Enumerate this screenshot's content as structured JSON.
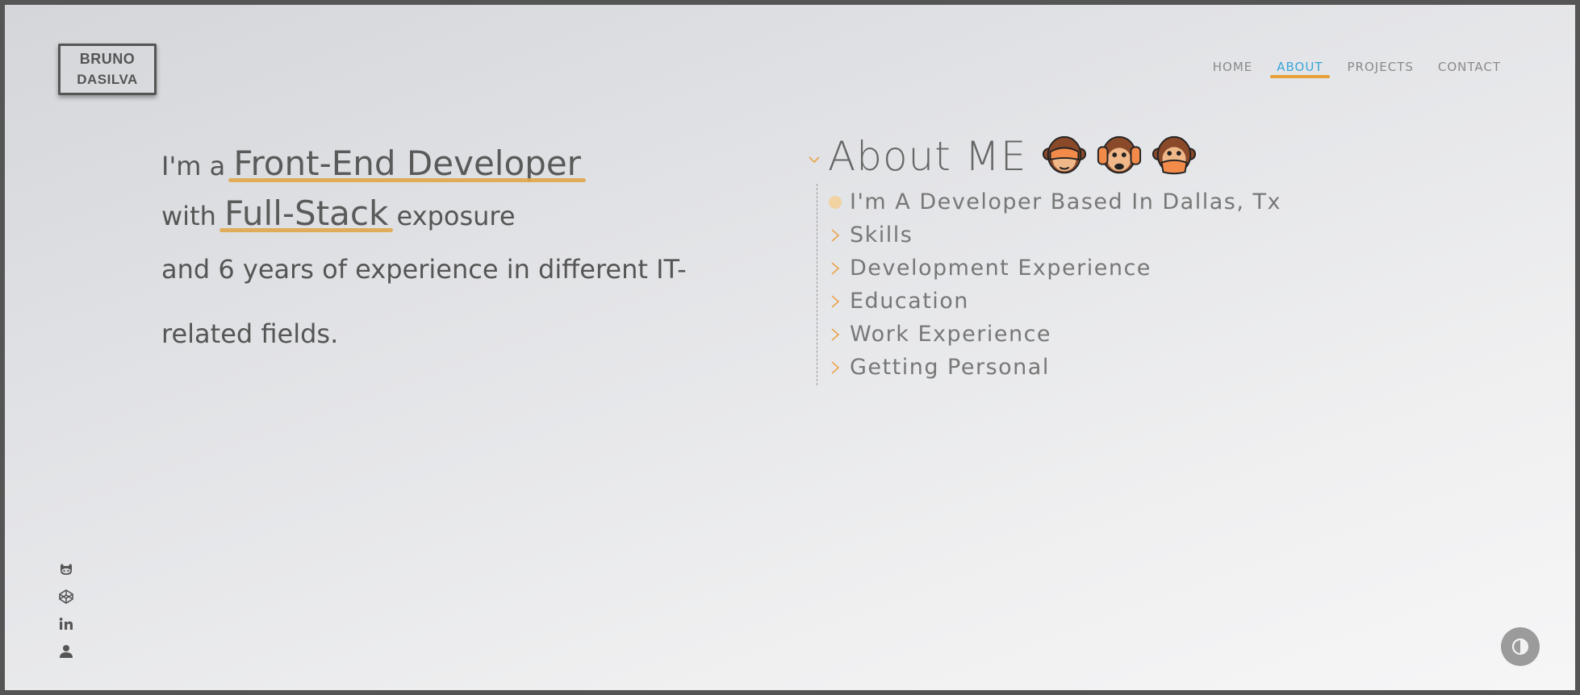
{
  "logo": {
    "line1": "BRUNO",
    "line2": "DASILVA"
  },
  "nav": {
    "items": [
      {
        "label": "HOME"
      },
      {
        "label": "ABOUT",
        "active": true
      },
      {
        "label": "PROJECTS"
      },
      {
        "label": "CONTACT"
      }
    ]
  },
  "intro": {
    "prefix": "I'm a",
    "role": "Front-End Developer",
    "with": "with",
    "stack": "Full-Stack",
    "exposure": "exposure",
    "line3": "and 6 years of experience in different IT-",
    "line4": "related fields."
  },
  "about": {
    "title": "About ME",
    "emojis": [
      "see-no-evil-monkey",
      "hear-no-evil-monkey",
      "speak-no-evil-monkey"
    ],
    "items": [
      {
        "label": "I'm A Developer Based In Dallas, Tx",
        "marker": "dot"
      },
      {
        "label": "Skills",
        "marker": "chevron"
      },
      {
        "label": "Development Experience",
        "marker": "chevron"
      },
      {
        "label": "Education",
        "marker": "chevron"
      },
      {
        "label": "Work Experience",
        "marker": "chevron"
      },
      {
        "label": "Getting Personal",
        "marker": "chevron"
      }
    ]
  },
  "social": [
    "github-icon",
    "codepen-icon",
    "linkedin-icon",
    "person-icon"
  ],
  "colors": {
    "accent": "#e7a03a",
    "active_link": "#3aa6d9",
    "text": "#555555"
  }
}
